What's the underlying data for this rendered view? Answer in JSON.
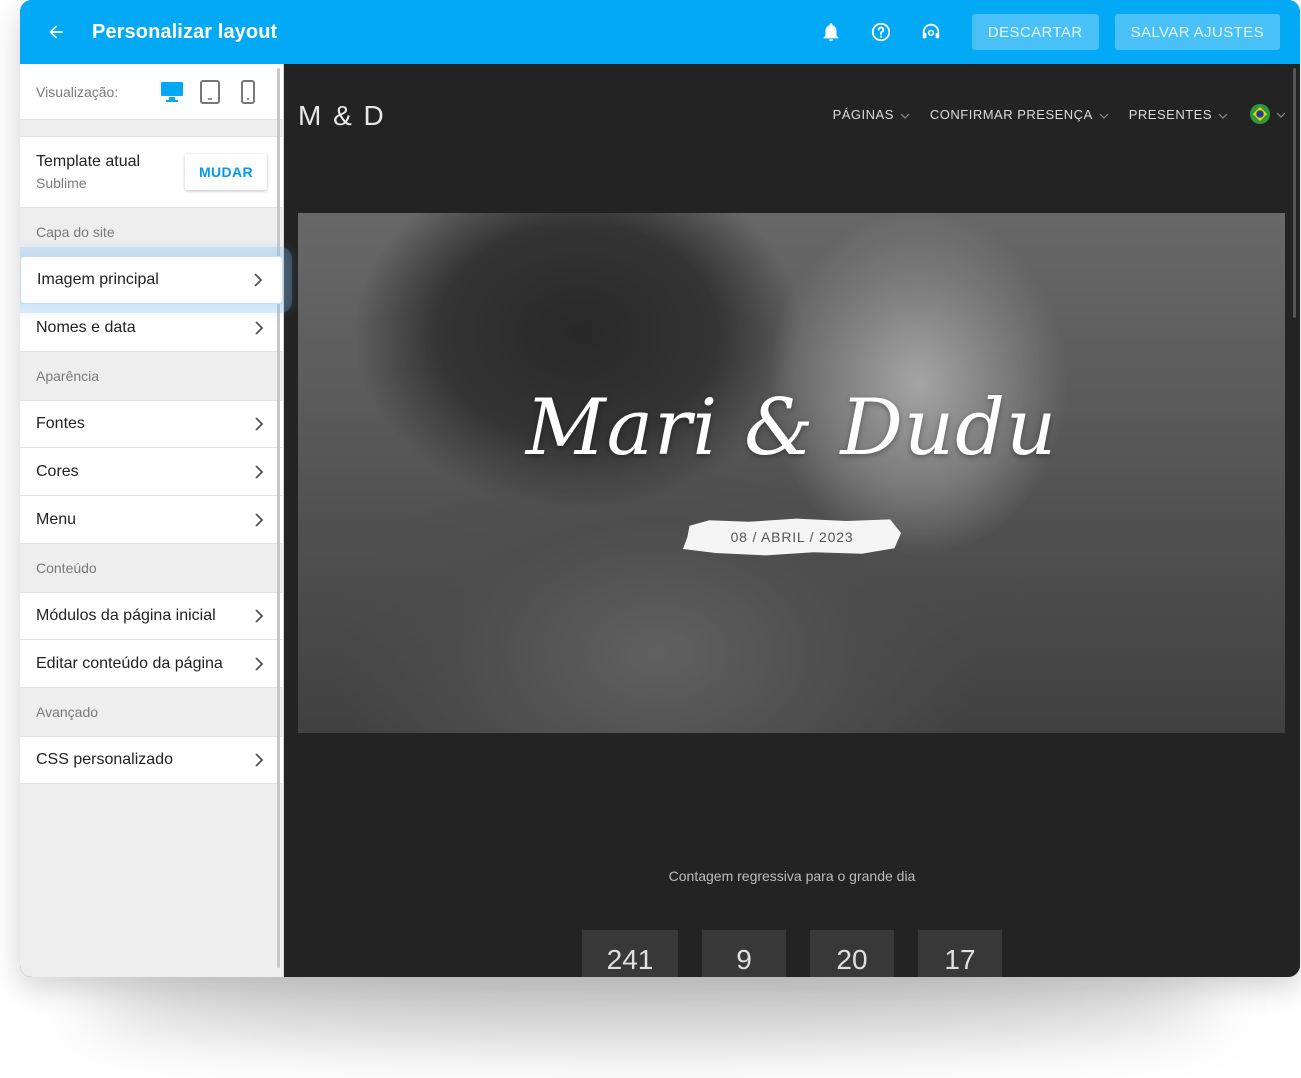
{
  "topbar": {
    "title": "Personalizar layout",
    "discard_label": "DESCARTAR",
    "save_label": "SALVAR AJUSTES",
    "accent_color": "#03a9f4",
    "icons": [
      "arrow-back-icon",
      "bell-icon",
      "help-circle-icon",
      "support-headset-icon"
    ]
  },
  "sidebar": {
    "visualization_label": "Visualização:",
    "view_icons": [
      "desktop-icon",
      "tablet-icon",
      "mobile-icon"
    ],
    "template": {
      "title": "Template atual",
      "name": "Sublime",
      "change_label": "MUDAR"
    },
    "sections": [
      {
        "header": "Capa do site",
        "items": [
          {
            "label": "Imagem principal"
          },
          {
            "label": "Nomes e data"
          }
        ]
      },
      {
        "header": "Aparência",
        "items": [
          {
            "label": "Fontes"
          },
          {
            "label": "Cores"
          },
          {
            "label": "Menu"
          }
        ]
      },
      {
        "header": "Conteúdo",
        "items": [
          {
            "label": "Módulos da página inicial"
          },
          {
            "label": "Editar conteúdo da página"
          }
        ]
      },
      {
        "header": "Avançado",
        "items": [
          {
            "label": "CSS personalizado"
          }
        ]
      }
    ]
  },
  "preview": {
    "logo": "M & D",
    "nav": [
      "PÁGINAS",
      "CONFIRMAR PRESENÇA",
      "PRESENTES"
    ],
    "flag": "brazil-flag-icon",
    "hero_names": "Mari & Dudu",
    "hero_date": "08 / ABRIL / 2023",
    "countdown_label": "Contagem regressiva para o grande dia",
    "countdown": [
      "241",
      "9",
      "20",
      "17"
    ]
  }
}
